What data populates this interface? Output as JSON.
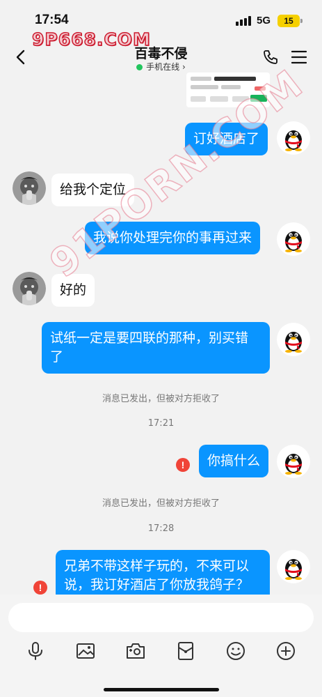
{
  "status_bar": {
    "time": "17:54",
    "network": "5G",
    "battery": "15"
  },
  "watermark": "9P668.COM",
  "watermark2": "91PORN.COM",
  "header": {
    "title": "百毒不侵",
    "subtitle": "手机在线",
    "subtitle_chevron": "›",
    "online_color": "#22c55e"
  },
  "messages": [
    {
      "id": "m1",
      "side": "out",
      "text": "订好酒店了"
    },
    {
      "id": "m2",
      "side": "in",
      "text": "给我个定位"
    },
    {
      "id": "m3",
      "side": "out",
      "text": "我说你处理完你的事再过来"
    },
    {
      "id": "m4",
      "side": "in",
      "text": "好的"
    },
    {
      "id": "m5",
      "side": "out",
      "line1": "试纸一定是要四联的那种，别买错",
      "line2": "了"
    },
    {
      "id": "sys1",
      "text": "消息已发出，但被对方拒收了"
    },
    {
      "id": "ts1",
      "text": "17:21"
    },
    {
      "id": "m6",
      "side": "out",
      "text": "你搞什么",
      "error": "!"
    },
    {
      "id": "sys2",
      "text": "消息已发出，但被对方拒收了"
    },
    {
      "id": "ts2",
      "text": "17:28"
    },
    {
      "id": "m7",
      "side": "out",
      "line1": "兄弟不带这样子玩的，不来可以",
      "line2": "说，我订好酒店了你放我鸽子？",
      "error": "!"
    }
  ],
  "colors": {
    "outgoing_bubble": "#0a95ff",
    "incoming_bubble": "#ffffff",
    "error_badge": "#f04438",
    "background": "#f2f2f2"
  },
  "toolbar": {
    "icons": [
      "microphone-icon",
      "image-icon",
      "camera-icon",
      "red-packet-icon",
      "emoji-icon",
      "plus-icon"
    ]
  },
  "input": {
    "value": "",
    "placeholder": ""
  }
}
